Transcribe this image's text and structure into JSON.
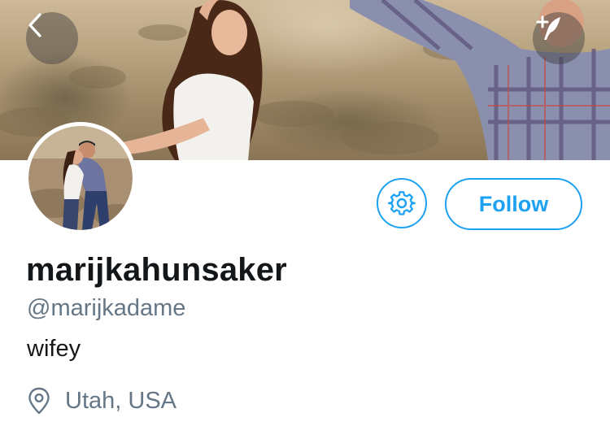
{
  "profile": {
    "display_name": "marijkahunsaker",
    "handle": "@marijkadame",
    "bio": "wifey",
    "location": "Utah, USA"
  },
  "actions": {
    "follow_label": "Follow"
  },
  "icons": {
    "back": "chevron-left-icon",
    "compose": "compose-tweet-icon",
    "settings": "gear-icon",
    "location": "location-pin-icon"
  },
  "colors": {
    "accent": "#1DA1F2",
    "text_primary": "#14171a",
    "text_secondary": "#657786"
  }
}
